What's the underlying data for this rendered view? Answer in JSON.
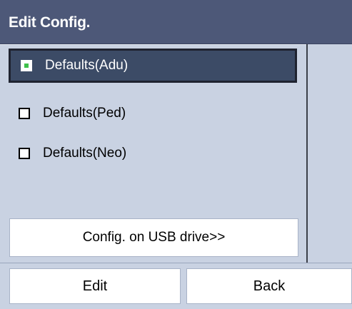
{
  "window": {
    "title": "Edit Config."
  },
  "options": [
    {
      "label": "Defaults(Adu)",
      "selected": true
    },
    {
      "label": "Defaults(Ped)",
      "selected": false
    },
    {
      "label": "Defaults(Neo)",
      "selected": false
    }
  ],
  "usb_button": {
    "label": "Config. on USB drive>>"
  },
  "footer": {
    "edit_label": "Edit",
    "back_label": "Back"
  },
  "colors": {
    "titlebar": "#4d5878",
    "panel": "#c9d2e2",
    "selected_row": "#3c4b66",
    "check_mark": "#3ec04b"
  }
}
